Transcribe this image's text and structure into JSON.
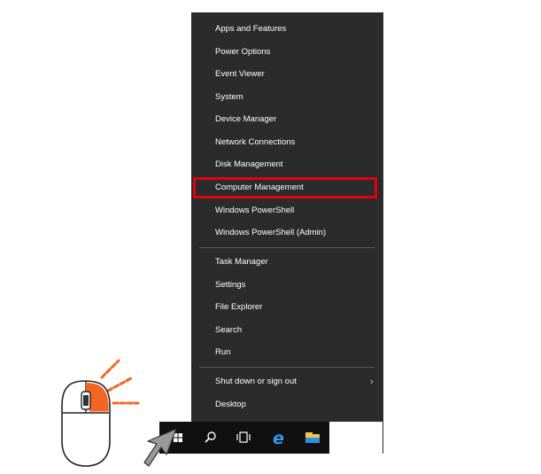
{
  "menu": {
    "items": [
      {
        "label": "Apps and Features"
      },
      {
        "label": "Power Options"
      },
      {
        "label": "Event Viewer"
      },
      {
        "label": "System"
      },
      {
        "label": "Device Manager"
      },
      {
        "label": "Network Connections"
      },
      {
        "label": "Disk Management"
      },
      {
        "label": "Computer Management"
      },
      {
        "label": "Windows PowerShell"
      },
      {
        "label": "Windows PowerShell (Admin)"
      },
      {
        "label": "Task Manager"
      },
      {
        "label": "Settings"
      },
      {
        "label": "File Explorer"
      },
      {
        "label": "Search"
      },
      {
        "label": "Run"
      },
      {
        "label": "Shut down or sign out",
        "has_submenu": true
      },
      {
        "label": "Desktop"
      }
    ],
    "highlighted_item": "Computer Management",
    "highlight_color": "#e3000f",
    "background": "#2b2b2b"
  },
  "taskbar": {
    "icons": [
      "start-icon",
      "search-icon",
      "task-view-icon",
      "edge-icon",
      "file-explorer-icon"
    ]
  },
  "illustration": {
    "mouse": "mouse-icon",
    "click_button": "right",
    "accent_color": "#f26522",
    "cursor": "arrow-cursor-icon"
  }
}
